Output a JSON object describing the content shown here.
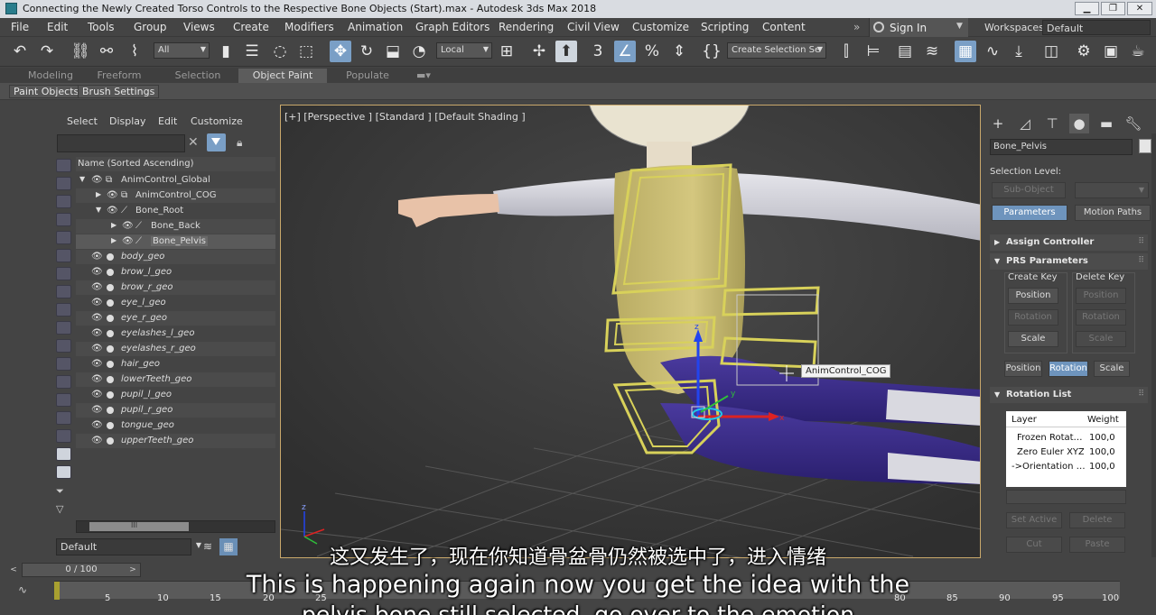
{
  "window": {
    "title": "Connecting the Newly Created Torso Controls to the Respective Bone Objects (Start).max - Autodesk 3ds Max 2018"
  },
  "menu": [
    "File",
    "Edit",
    "Tools",
    "Group",
    "Views",
    "Create",
    "Modifiers",
    "Animation",
    "Graph Editors",
    "Rendering",
    "Civil View",
    "Customize",
    "Scripting",
    "Content"
  ],
  "account": {
    "sign_in": "Sign In"
  },
  "workspace": {
    "label": "Workspaces:",
    "value": "Default"
  },
  "toolbar": {
    "filter_value": "All",
    "coord_value": "Local",
    "selection_set_placeholder": "Create Selection Se"
  },
  "ribbon": {
    "tabs": [
      "Modeling",
      "Freeform",
      "Selection",
      "Object Paint",
      "Populate"
    ],
    "active_tab": "Object Paint",
    "sub_tabs": [
      "Paint Objects",
      "Brush Settings"
    ]
  },
  "scene_explorer": {
    "menu": [
      "Select",
      "Display",
      "Edit",
      "Customize"
    ],
    "column_header": "Name (Sorted Ascending)",
    "rows": [
      {
        "name": "AnimControl_Global",
        "italic": false
      },
      {
        "name": "AnimControl_COG",
        "italic": false
      },
      {
        "name": "Bone_Root",
        "italic": false
      },
      {
        "name": "Bone_Back",
        "italic": false
      },
      {
        "name": "Bone_Pelvis",
        "italic": false
      },
      {
        "name": "body_geo",
        "italic": true
      },
      {
        "name": "brow_l_geo",
        "italic": true
      },
      {
        "name": "brow_r_geo",
        "italic": true
      },
      {
        "name": "eye_l_geo",
        "italic": true
      },
      {
        "name": "eye_r_geo",
        "italic": true
      },
      {
        "name": "eyelashes_l_geo",
        "italic": true
      },
      {
        "name": "eyelashes_r_geo",
        "italic": true
      },
      {
        "name": "hair_geo",
        "italic": true
      },
      {
        "name": "lowerTeeth_geo",
        "italic": true
      },
      {
        "name": "pupil_l_geo",
        "italic": true
      },
      {
        "name": "pupil_r_geo",
        "italic": true
      },
      {
        "name": "tongue_geo",
        "italic": true
      },
      {
        "name": "upperTeeth_geo",
        "italic": true
      }
    ],
    "scroll_thumb_label": "III",
    "layer_value": "Default"
  },
  "viewport": {
    "label": "[+] [Perspective ] [Standard ] [Default Shading ]",
    "tooltip": "AnimControl_COG",
    "axis_x": "x",
    "axis_y": "y",
    "axis_z": "z"
  },
  "command_panel": {
    "object_name": "Bone_Pelvis",
    "selection_level_label": "Selection Level:",
    "sub_object": "Sub-Object",
    "parameters": "Parameters",
    "motion_paths": "Motion Paths",
    "assign_controller": "Assign Controller",
    "prs_parameters": "PRS Parameters",
    "create_key": "Create Key",
    "delete_key": "Delete Key",
    "position": "Position",
    "rotation": "Rotation",
    "scale": "Scale",
    "rotation_list": "Rotation List",
    "list_headers": [
      "Layer",
      "Weight"
    ],
    "list_rows": [
      {
        "layer": "Frozen Rotat…",
        "weight": "100,0"
      },
      {
        "layer": "Zero Euler XYZ",
        "weight": "100,0"
      },
      {
        "layer": "->Orientation …",
        "weight": "100,0"
      }
    ],
    "set_active": "Set Active",
    "delete": "Delete",
    "cut": "Cut",
    "paste": "Paste"
  },
  "timeline": {
    "frame": "0 / 100",
    "ticks": [
      "5",
      "10",
      "15",
      "20",
      "25",
      "80",
      "85",
      "90",
      "95",
      "100"
    ]
  },
  "subtitles": {
    "zh": "这又发生了，现在你知道骨盆骨仍然被选中了，进入情绪",
    "en": "This is happening again now you get the idea with the",
    "en2": "pelvis bone still selected, go over to the emotion"
  },
  "colors": {
    "accent": "#7a9fc6",
    "viewport_border": "#c9a86b",
    "rig_yellow": "#d8d15a",
    "shirt": "#c7bb72",
    "pants": "#3a2d8c"
  }
}
